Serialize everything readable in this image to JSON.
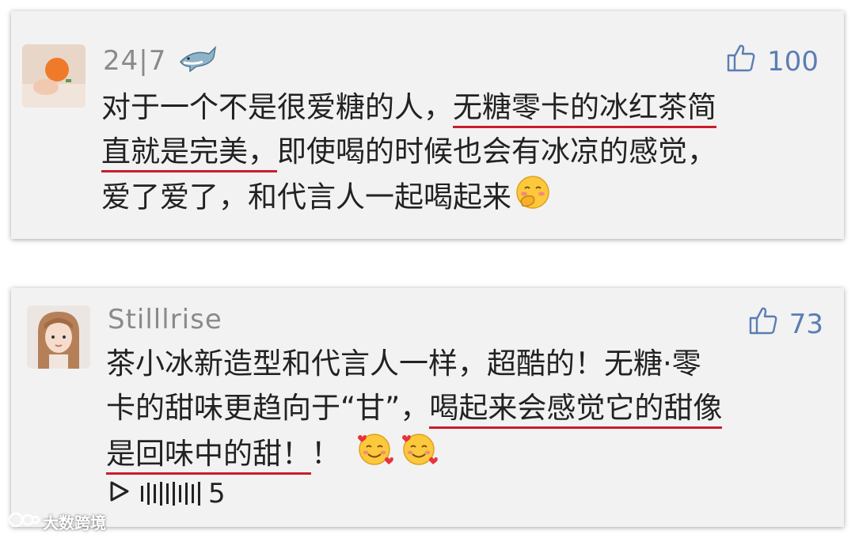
{
  "comments": [
    {
      "username": "24|7",
      "username_emoji": "shark-emoji",
      "likes": "100",
      "lines": [
        {
          "plain": "对于一个不是很爱糖的人，",
          "underlined": "无糖零卡的冰红茶简"
        },
        {
          "underlined": "直就是完美，",
          "plain": "即使喝的时候也会有冰凉的感觉，"
        },
        {
          "plain": "爱了爱了，和代言人一起喝起来"
        }
      ],
      "trailing_emoji": "hand-over-mouth-emoji"
    },
    {
      "username": "Stilllrise",
      "likes": "73",
      "lines": [
        {
          "plain": "茶小冰新造型和代言人一样，超酷的！无糖·零"
        },
        {
          "plain": "卡的甜味更趋向于“甘”，",
          "underlined": "喝起来会感觉它的甜像"
        },
        {
          "underlined": "是回味中的甜！",
          "plain": "！"
        }
      ],
      "trailing_emoji": "smiling-face-with-hearts-emoji",
      "voice": {
        "icon": "play-icon",
        "count": "5"
      }
    }
  ],
  "watermark": "大数跨境",
  "colors": {
    "underline": "#c81e2a",
    "like": "#5b7db3",
    "username": "#8a8a8a"
  }
}
